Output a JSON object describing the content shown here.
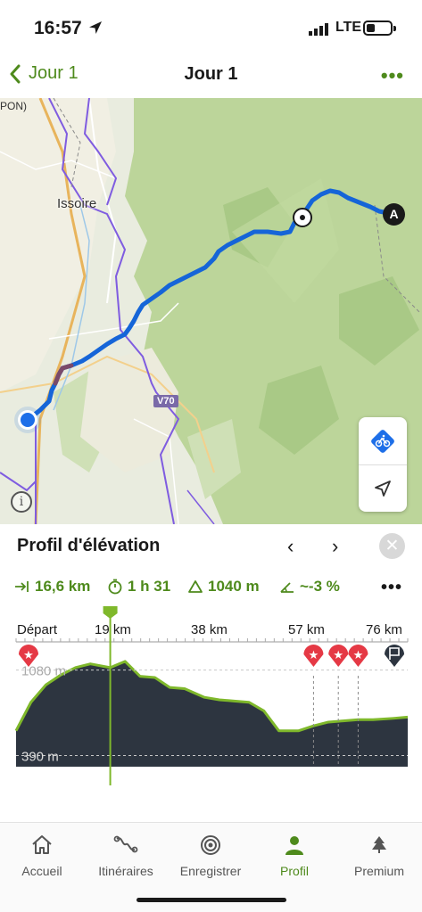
{
  "status_bar": {
    "time": "16:57",
    "network": "LTE"
  },
  "nav": {
    "back_label": "Jour 1",
    "title": "Jour 1",
    "more_label": "•••"
  },
  "map": {
    "labels": {
      "town": "Issoire",
      "top_left": "PON)",
      "road": "V70"
    },
    "end_marker": "A",
    "colors": {
      "route": "#1565d8",
      "route_steep": "#7a4a6a",
      "boundary": "#7f5ce0",
      "forest": "#bcd59a",
      "plain": "#e9ecdf",
      "road_major": "#e8b45c"
    },
    "controls": {
      "bike_icon": "bike-route-icon",
      "locate_icon": "navigation-arrow-icon"
    },
    "info_label": "i"
  },
  "profile": {
    "title": "Profil d'élévation",
    "prev_label": "‹",
    "next_label": "›",
    "close_label": "✕",
    "stats": {
      "distance": "16,6 km",
      "duration": "1 h 31",
      "ascent": "1040 m",
      "grade": "~-3 %",
      "more_label": "•••"
    },
    "x_axis": {
      "start": "Départ",
      "ticks": [
        "19 km",
        "38 km",
        "57 km",
        "76 km"
      ]
    },
    "y_labels": [
      "1080 m",
      "390 m"
    ],
    "colors": {
      "area": "#2d3540",
      "line": "#7fb82b",
      "cursor": "#7fb82b",
      "poi_red": "#e53945",
      "poi_dark": "#2d3540"
    }
  },
  "chart_data": {
    "type": "area",
    "title": "Profil d'élévation",
    "xlabel": "",
    "ylabel": "",
    "x": [
      0,
      3,
      6,
      9,
      12,
      15,
      19,
      22,
      25,
      28,
      31,
      34,
      38,
      41,
      44,
      47,
      50,
      53,
      57,
      60,
      63,
      66,
      69,
      72,
      76,
      79
    ],
    "y": [
      590,
      820,
      960,
      1040,
      1100,
      1130,
      1100,
      1150,
      1030,
      1020,
      940,
      930,
      860,
      840,
      830,
      820,
      750,
      590,
      590,
      630,
      660,
      670,
      680,
      680,
      690,
      700
    ],
    "x_ticks": [
      "Départ",
      "19 km",
      "38 km",
      "57 km",
      "76 km"
    ],
    "y_ticks": [
      "1080 m",
      "390 m"
    ],
    "cursor_km": 19
  },
  "tabs": [
    {
      "label": "Accueil",
      "icon": "home-icon"
    },
    {
      "label": "Itinéraires",
      "icon": "route-icon"
    },
    {
      "label": "Enregistrer",
      "icon": "record-icon"
    },
    {
      "label": "Profil",
      "icon": "profile-icon",
      "active": true
    },
    {
      "label": "Premium",
      "icon": "premium-icon"
    }
  ]
}
